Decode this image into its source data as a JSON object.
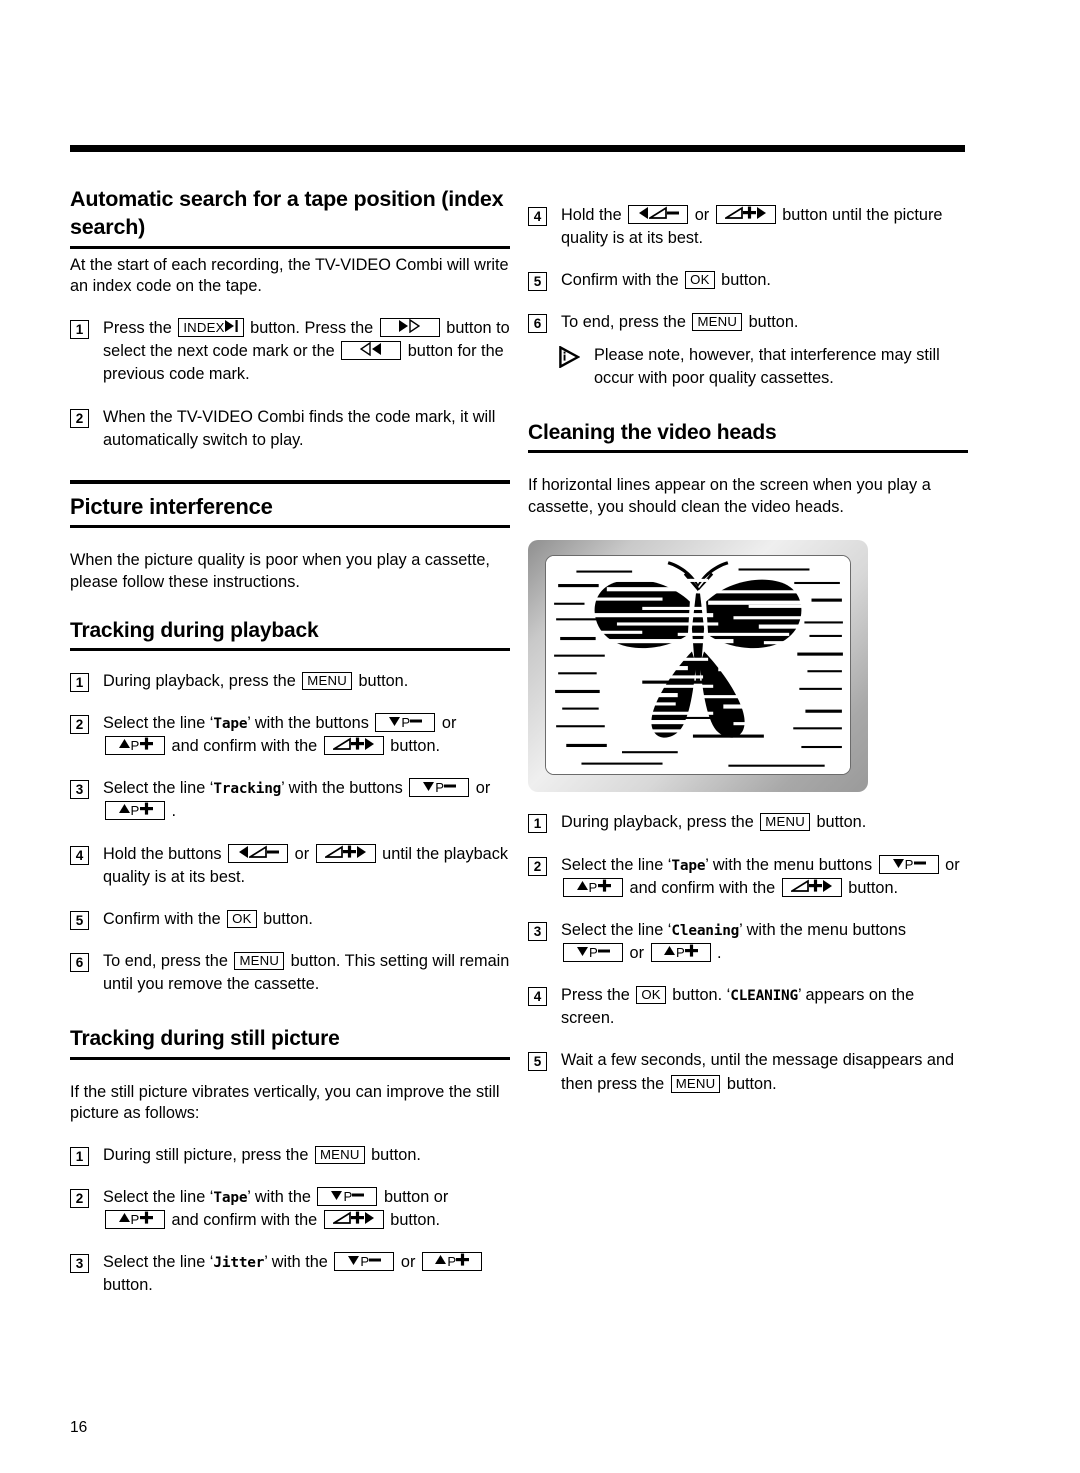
{
  "page": {
    "number": "16"
  },
  "left_column": {
    "section1": {
      "title": "Automatic search for a tape position (index search)",
      "intro": "At the start of each recording, the TV-VIDEO Combi will write an index code on the tape.",
      "steps": [
        {
          "num": "1",
          "parts": [
            {
              "type": "text",
              "value": "Press the "
            },
            {
              "type": "key",
              "value": "INDEX",
              "icon": "skip-forward-icon"
            },
            {
              "type": "text",
              "value": " button. Press the "
            },
            {
              "type": "key",
              "value": "",
              "icon": "fast-forward-icon"
            },
            {
              "type": "text",
              "value": " button to select the next code mark or the "
            },
            {
              "type": "key",
              "value": "",
              "icon": "rewind-icon"
            },
            {
              "type": "text",
              "value": " button for the previous code mark."
            }
          ]
        },
        {
          "num": "2",
          "parts": [
            {
              "type": "text",
              "value": "When the TV-VIDEO Combi finds the code mark, it will automatically switch to play."
            }
          ]
        }
      ]
    },
    "section2": {
      "title": "Picture interference",
      "intro": "When the picture quality is poor when you play a cassette, please follow these instructions.",
      "sub1": {
        "title": "Tracking during playback",
        "steps": [
          {
            "num": "1",
            "parts": [
              {
                "type": "text",
                "value": "During playback, press the "
              },
              {
                "type": "key",
                "value": "MENU",
                "icon": "menu-key"
              },
              {
                "type": "text",
                "value": " button."
              }
            ]
          },
          {
            "num": "2",
            "parts": [
              {
                "type": "text",
                "value": "Select the line ‘"
              },
              {
                "type": "mono",
                "value": "Tape"
              },
              {
                "type": "text",
                "value": "’ with the buttons "
              },
              {
                "type": "key",
                "value": "P",
                "icon": "program-down-icon"
              },
              {
                "type": "text",
                "value": " or "
              },
              {
                "type": "key",
                "value": "P",
                "icon": "program-up-icon"
              },
              {
                "type": "text",
                "value": " and confirm with the "
              },
              {
                "type": "key",
                "value": "",
                "icon": "volume-up-right-icon"
              },
              {
                "type": "text",
                "value": " button."
              }
            ]
          },
          {
            "num": "3",
            "parts": [
              {
                "type": "text",
                "value": "Select the line ‘"
              },
              {
                "type": "mono",
                "value": "Tracking"
              },
              {
                "type": "text",
                "value": "’ with the buttons "
              },
              {
                "type": "key",
                "value": "P",
                "icon": "program-down-icon"
              },
              {
                "type": "text",
                "value": " or "
              },
              {
                "type": "key",
                "value": "P",
                "icon": "program-up-icon"
              },
              {
                "type": "text",
                "value": " ."
              }
            ]
          },
          {
            "num": "4",
            "parts": [
              {
                "type": "text",
                "value": "Hold the buttons "
              },
              {
                "type": "key",
                "value": "",
                "icon": "volume-down-left-icon"
              },
              {
                "type": "text",
                "value": " or "
              },
              {
                "type": "key",
                "value": "",
                "icon": "volume-up-right-icon"
              },
              {
                "type": "text",
                "value": " until the playback quality is at its best."
              }
            ]
          },
          {
            "num": "5",
            "parts": [
              {
                "type": "text",
                "value": "Confirm with the "
              },
              {
                "type": "key",
                "value": "OK",
                "icon": "ok-key"
              },
              {
                "type": "text",
                "value": " button."
              }
            ]
          },
          {
            "num": "6",
            "parts": [
              {
                "type": "text",
                "value": "To end, press the "
              },
              {
                "type": "key",
                "value": "MENU",
                "icon": "menu-key"
              },
              {
                "type": "text",
                "value": " button. This setting will remain until you remove the cassette."
              }
            ]
          }
        ]
      },
      "sub2": {
        "title": "Tracking during still picture",
        "intro": "If the still picture vibrates vertically, you can improve the still picture as follows:",
        "steps": [
          {
            "num": "1",
            "parts": [
              {
                "type": "text",
                "value": "During still picture, press the "
              },
              {
                "type": "key",
                "value": "MENU",
                "icon": "menu-key"
              },
              {
                "type": "text",
                "value": " button."
              }
            ]
          },
          {
            "num": "2",
            "parts": [
              {
                "type": "text",
                "value": "Select the line ‘"
              },
              {
                "type": "mono",
                "value": "Tape"
              },
              {
                "type": "text",
                "value": "’ with the "
              },
              {
                "type": "key",
                "value": "P",
                "icon": "program-down-icon"
              },
              {
                "type": "text",
                "value": " button or "
              },
              {
                "type": "key",
                "value": "P",
                "icon": "program-up-icon"
              },
              {
                "type": "text",
                "value": " and confirm with the "
              },
              {
                "type": "key",
                "value": "",
                "icon": "volume-up-right-icon"
              },
              {
                "type": "text",
                "value": " button."
              }
            ]
          },
          {
            "num": "3",
            "parts": [
              {
                "type": "text",
                "value": "Select the line ‘"
              },
              {
                "type": "mono",
                "value": "Jitter"
              },
              {
                "type": "text",
                "value": "’ with the "
              },
              {
                "type": "key",
                "value": "P",
                "icon": "program-down-icon"
              },
              {
                "type": "text",
                "value": " or "
              },
              {
                "type": "key",
                "value": "P",
                "icon": "program-up-icon"
              },
              {
                "type": "text",
                "value": " button."
              }
            ]
          }
        ]
      }
    }
  },
  "right_column": {
    "continued_steps": [
      {
        "num": "4",
        "parts": [
          {
            "type": "text",
            "value": "Hold the "
          },
          {
            "type": "key",
            "value": "",
            "icon": "volume-down-left-icon"
          },
          {
            "type": "text",
            "value": " or "
          },
          {
            "type": "key",
            "value": "",
            "icon": "volume-up-right-icon"
          },
          {
            "type": "text",
            "value": " button until the picture quality is at its best."
          }
        ]
      },
      {
        "num": "5",
        "parts": [
          {
            "type": "text",
            "value": "Confirm with the "
          },
          {
            "type": "key",
            "value": "OK",
            "icon": "ok-key"
          },
          {
            "type": "text",
            "value": " button."
          }
        ]
      },
      {
        "num": "6",
        "parts": [
          {
            "type": "text",
            "value": "To end, press the "
          },
          {
            "type": "key",
            "value": "MENU",
            "icon": "menu-key"
          },
          {
            "type": "text",
            "value": " button."
          }
        ],
        "note": "Please note, however, that interference may still occur with poor quality cassettes."
      }
    ],
    "section": {
      "title": "Cleaning the video heads",
      "intro": "If horizontal lines appear on the screen when you play a cassette, you should clean the video heads.",
      "image": {
        "name": "tv-interference-picture",
        "alt": "Television screen showing a butterfly picture broken up by horizontal interference lines"
      },
      "steps": [
        {
          "num": "1",
          "parts": [
            {
              "type": "text",
              "value": "During playback, press the "
            },
            {
              "type": "key",
              "value": "MENU",
              "icon": "menu-key"
            },
            {
              "type": "text",
              "value": " button."
            }
          ]
        },
        {
          "num": "2",
          "parts": [
            {
              "type": "text",
              "value": "Select the line ‘"
            },
            {
              "type": "mono",
              "value": "Tape"
            },
            {
              "type": "text",
              "value": "’ with the menu buttons "
            },
            {
              "type": "key",
              "value": "P",
              "icon": "program-down-icon"
            },
            {
              "type": "text",
              "value": " or "
            },
            {
              "type": "key",
              "value": "P",
              "icon": "program-up-icon"
            },
            {
              "type": "text",
              "value": " and confirm with the "
            },
            {
              "type": "key",
              "value": "",
              "icon": "volume-up-right-icon"
            },
            {
              "type": "text",
              "value": " button."
            }
          ]
        },
        {
          "num": "3",
          "parts": [
            {
              "type": "text",
              "value": "Select the line ‘"
            },
            {
              "type": "mono",
              "value": "Cleaning"
            },
            {
              "type": "text",
              "value": "’ with the menu buttons "
            },
            {
              "type": "key",
              "value": "P",
              "icon": "program-down-icon"
            },
            {
              "type": "text",
              "value": " or "
            },
            {
              "type": "key",
              "value": "P",
              "icon": "program-up-icon"
            },
            {
              "type": "text",
              "value": " ."
            }
          ]
        },
        {
          "num": "4",
          "parts": [
            {
              "type": "text",
              "value": "Press the "
            },
            {
              "type": "key",
              "value": "OK",
              "icon": "ok-key"
            },
            {
              "type": "text",
              "value": " button. ‘"
            },
            {
              "type": "mono",
              "value": "CLEANING"
            },
            {
              "type": "text",
              "value": "’ appears on the screen."
            }
          ]
        },
        {
          "num": "5",
          "parts": [
            {
              "type": "text",
              "value": "Wait a few seconds, until the message disappears and then press the "
            },
            {
              "type": "key",
              "value": "MENU",
              "icon": "menu-key"
            },
            {
              "type": "text",
              "value": " button."
            }
          ]
        }
      ]
    }
  },
  "key_labels": {
    "index": "INDEX",
    "menu": "MENU",
    "ok": "OK",
    "program": "P"
  }
}
